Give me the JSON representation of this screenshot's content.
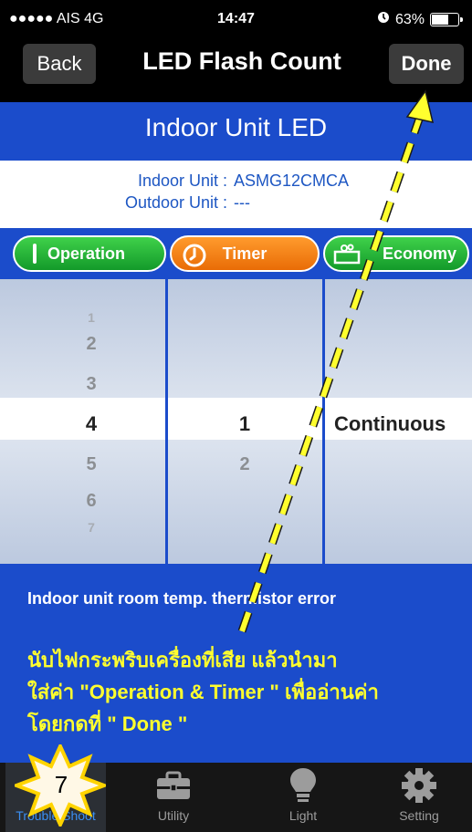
{
  "status_bar": {
    "carrier": "●●●●● AIS  4G",
    "time": "14:47",
    "battery": "63%"
  },
  "nav": {
    "back_label": "Back",
    "title": "LED Flash Count",
    "done_label": "Done"
  },
  "header": {
    "title": "Indoor Unit LED"
  },
  "unit_info": {
    "indoor_label": "Indoor Unit :",
    "indoor_value": "ASMG12CMCA",
    "outdoor_label": "Outdoor Unit :",
    "outdoor_value": "---"
  },
  "tabs": {
    "operation": "Operation",
    "timer": "Timer",
    "economy": "Economy"
  },
  "picker": {
    "operation": {
      "above": [
        "1",
        "2",
        "3"
      ],
      "selected": "4",
      "below": [
        "5",
        "6",
        "7"
      ]
    },
    "timer": {
      "selected": "1",
      "below": [
        "2"
      ]
    },
    "economy": {
      "selected": "Continuous"
    }
  },
  "error_message": "Indoor unit room temp. thermistor error",
  "instruction_note": "นับไฟกระพริบเครื่องที่เสีย แล้วนำมา\nใส่ค่า \"Operation & Timer \" เพื่ออ่านค่า\nโดยกดที่ \" Done \"",
  "step_badge": "7",
  "tab_bar": [
    {
      "label": "Trouble Shoot",
      "icon": "trouble-shoot-icon",
      "active": true
    },
    {
      "label": "Utility",
      "icon": "toolbox-icon",
      "active": false
    },
    {
      "label": "Light",
      "icon": "lightbulb-icon",
      "active": false
    },
    {
      "label": "Setting",
      "icon": "gear-icon",
      "active": false
    }
  ],
  "colors": {
    "brand_blue": "#1b4ccb",
    "operation_green": "#139a2a",
    "timer_orange": "#e96c06",
    "annotation_yellow": "#ffff2e"
  }
}
